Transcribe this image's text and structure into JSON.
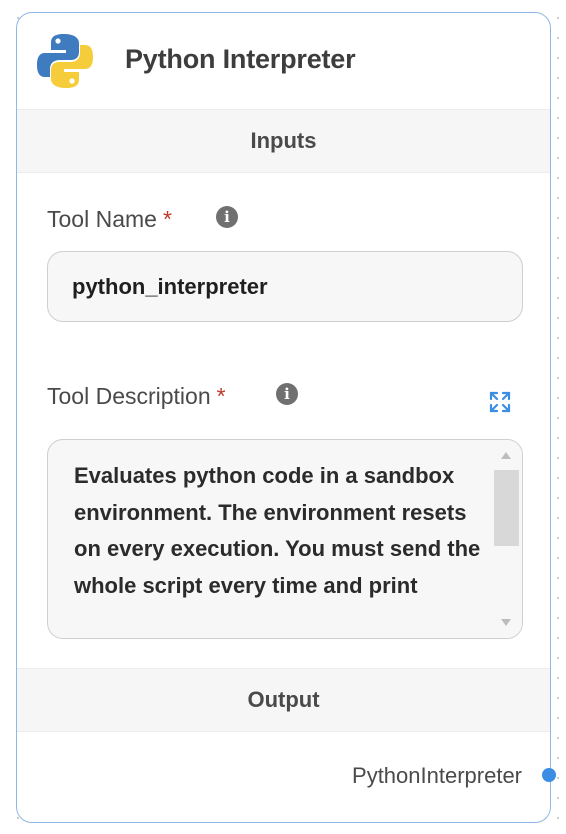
{
  "node": {
    "title": "Python Interpreter",
    "logo_icon": "python-logo-icon"
  },
  "inputs_section": {
    "label": "Inputs"
  },
  "tool_name": {
    "label": "Tool Name",
    "required_marker": "*",
    "info_icon": "info-icon",
    "value": "python_interpreter"
  },
  "tool_description": {
    "label": "Tool Description",
    "required_marker": "*",
    "info_icon": "info-icon",
    "expand_icon": "expand-icon",
    "value": "Evaluates python code in a sandbox environment. The environment resets on every execution. You must send the whole script every time and print"
  },
  "output_section": {
    "label": "Output"
  },
  "output": {
    "label": "PythonInterpreter"
  },
  "colors": {
    "accent": "#3b8ee4",
    "border": "#8fb8e6",
    "required": "#c0392b"
  }
}
